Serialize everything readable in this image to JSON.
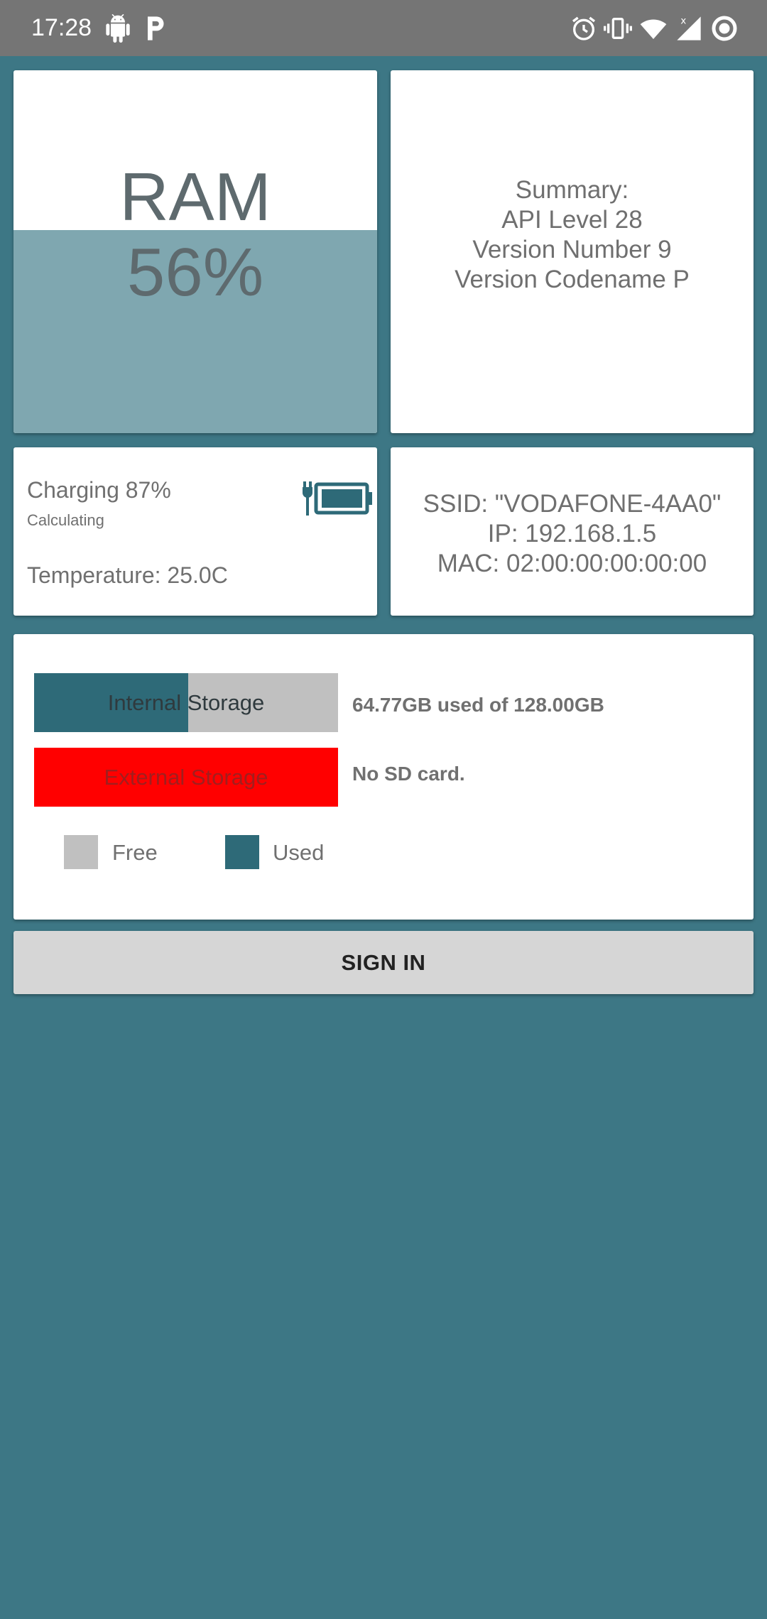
{
  "status_bar": {
    "time": "17:28",
    "left_icons": [
      "android-icon",
      "parking-p-icon"
    ],
    "right_icons": [
      "alarm-icon",
      "vibrate-icon",
      "wifi-icon",
      "cell-signal-icon",
      "record-icon"
    ]
  },
  "ram": {
    "label": "RAM",
    "percent_text": "56%",
    "used_fraction": 0.56,
    "fill_color": "#7fa7b0"
  },
  "summary": {
    "lines": [
      "Summary:",
      "API Level 28",
      "Version Number 9",
      "Version Codename P"
    ]
  },
  "battery": {
    "charging_text": "Charging 87%",
    "status_text": "Calculating",
    "temperature_text": "Temperature: 25.0C",
    "icon": "battery-charging-icon"
  },
  "network": {
    "ssid": "SSID: \"VODAFONE-4AA0\"",
    "ip": "IP: 192.168.1.5",
    "mac": "MAC: 02:00:00:00:00:00"
  },
  "storage": {
    "internal": {
      "label": "Internal Storage",
      "info": "64.77GB used of 128.00GB",
      "used_fraction": 0.506
    },
    "external": {
      "label": "External Storage",
      "info": "No SD card.",
      "color": "#ff0000"
    },
    "legend": {
      "free_label": "Free",
      "used_label": "Used",
      "free_color": "#c0c0c0",
      "used_color": "#2e6a78"
    }
  },
  "sign_in": {
    "label": "SIGN IN"
  },
  "colors": {
    "background": "#3d7785",
    "status_bar": "#757575",
    "accent": "#2e6a78"
  }
}
